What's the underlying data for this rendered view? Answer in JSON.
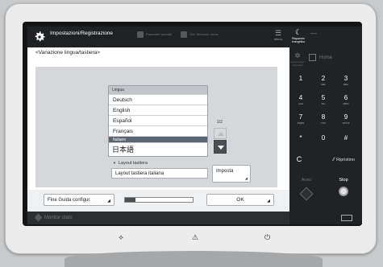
{
  "header": {
    "title": "Impostazioni/Registrazione",
    "menu_items": [
      "Parametri speciali",
      "Ord. Memoriz. Avvio"
    ],
    "menu_label": "Menu"
  },
  "breadcrumb": "<Variazione lingua/tastiera>",
  "language_list": {
    "header": "Lingua",
    "items": [
      "Deutsch",
      "English",
      "Español",
      "Français",
      "Italiano",
      "日本語"
    ],
    "selected": "Italiano"
  },
  "pagination": "1/2",
  "layout": {
    "label": "Layout tastiera",
    "value": "Layout tastiera italiana",
    "set_button": "Imposta"
  },
  "footer": {
    "finish_guide": "Fine Guida configur.",
    "ok": "OK",
    "progress": 0.15
  },
  "status_bar": {
    "text": "Monitor stato"
  },
  "right_panel": {
    "energy_saver": "Risparmio energetico",
    "monitor": "Monitoraggio dispositivi",
    "home": "Home",
    "keys": [
      {
        "digit": "1",
        "sub": ""
      },
      {
        "digit": "2",
        "sub": "ABC"
      },
      {
        "digit": "3",
        "sub": "DEF"
      },
      {
        "digit": "4",
        "sub": "GHI"
      },
      {
        "digit": "5",
        "sub": "JKL"
      },
      {
        "digit": "6",
        "sub": "MNO"
      },
      {
        "digit": "7",
        "sub": "PQRS"
      },
      {
        "digit": "8",
        "sub": "TUV"
      },
      {
        "digit": "9",
        "sub": "WXYZ"
      },
      {
        "digit": "*",
        "sub": ""
      },
      {
        "digit": "0",
        "sub": ""
      },
      {
        "digit": "#",
        "sub": ""
      }
    ],
    "clear": "C",
    "reset": "Ripristino",
    "start": "Avvio",
    "stop": "Stop"
  }
}
